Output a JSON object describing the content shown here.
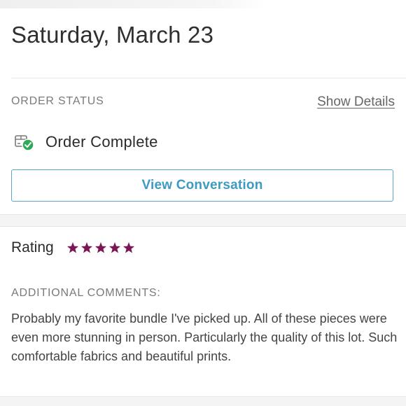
{
  "header": {
    "date": "Saturday, March 23"
  },
  "order": {
    "status_label": "ORDER STATUS",
    "show_details_label": "Show Details",
    "status_text": "Order Complete",
    "status_icon": "package-check-icon",
    "view_conversation_label": "View Conversation"
  },
  "rating": {
    "label": "Rating",
    "stars": 5,
    "max_stars": 5,
    "star_color": "#7a1653"
  },
  "comments": {
    "label": "ADDITIONAL COMMENTS:",
    "text": "Probably my favorite bundle I've picked up. All of these pieces were even more stunning in person. Particularly the quality of this lot. Such comfortable fabrics and beautiful prints."
  },
  "colors": {
    "accent": "#3d9ac0",
    "success": "#2eaa57"
  }
}
